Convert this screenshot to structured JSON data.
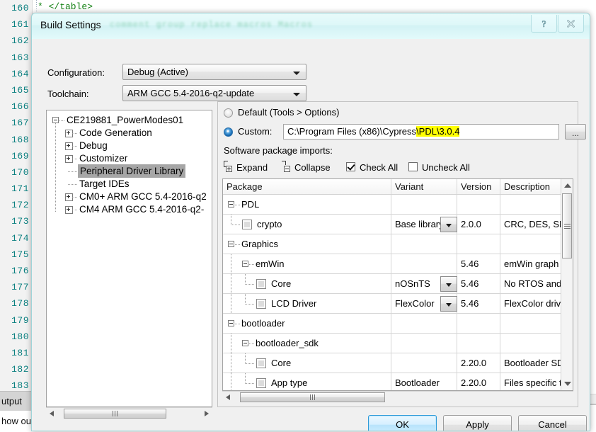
{
  "editor": {
    "line_numbers": [
      "160",
      "161",
      "162",
      "163",
      "164",
      "165",
      "166",
      "167",
      "168",
      "169",
      "170",
      "171",
      "172",
      "173",
      "174",
      "175",
      "176",
      "177",
      "178",
      "179",
      "180",
      "181",
      "182",
      "183"
    ],
    "code_first_line": "* </table>",
    "ghost_title_text": "comment group replace macros Macros"
  },
  "bottom_panel": {
    "tab_label": "utput",
    "row_label": "how ou"
  },
  "dialog": {
    "title": "Build Settings",
    "help_button": "?",
    "close_button": "✕",
    "fields": {
      "configuration_label": "Configuration:",
      "configuration_value": "Debug (Active)",
      "toolchain_label": "Toolchain:",
      "toolchain_value": "ARM GCC 5.4-2016-q2-update"
    },
    "tree": {
      "root": "CE219881_PowerModes01",
      "items": [
        {
          "label": "Code Generation",
          "expandable": true,
          "selected": false
        },
        {
          "label": "Debug",
          "expandable": true,
          "selected": false
        },
        {
          "label": "Customizer",
          "expandable": true,
          "selected": false
        },
        {
          "label": "Peripheral Driver Library",
          "expandable": false,
          "selected": true
        },
        {
          "label": "Target IDEs",
          "expandable": false,
          "selected": false
        },
        {
          "label": "CM0+ ARM GCC 5.4-2016-q2",
          "expandable": true,
          "selected": false
        },
        {
          "label": "CM4 ARM GCC 5.4-2016-q2-",
          "expandable": true,
          "selected": false
        }
      ]
    },
    "pdl": {
      "default_option": "Default (Tools > Options)",
      "custom_option": "Custom:",
      "selected_option": "custom",
      "path_prefix": "C:\\Program Files (x86)\\Cypress",
      "path_highlight": "\\PDL\\3.0.4",
      "browse_button": "...",
      "imports_label": "Software package imports:",
      "toolbar": {
        "expand": "Expand",
        "collapse": "Collapse",
        "check_all": "Check All",
        "uncheck_all": "Uncheck All",
        "check_all_state": true,
        "uncheck_all_state": false
      }
    },
    "grid": {
      "columns": [
        "Package",
        "Variant",
        "Version",
        "Description"
      ],
      "rows": [
        {
          "indent": 0,
          "kind": "group",
          "name": "PDL",
          "variant": "",
          "version": "",
          "description": ""
        },
        {
          "indent": 1,
          "kind": "item",
          "name": "crypto",
          "variant": "Base library",
          "version": "2.0.0",
          "description": "CRC, DES, SHA"
        },
        {
          "indent": 0,
          "kind": "group",
          "name": "Graphics",
          "variant": "",
          "version": "",
          "description": ""
        },
        {
          "indent": 1,
          "kind": "group",
          "name": "emWin",
          "variant": "",
          "version": "5.46",
          "description": "emWin graph"
        },
        {
          "indent": 2,
          "kind": "item",
          "name": "Core",
          "variant": "nOSnTS",
          "version": "5.46",
          "description": "No RTOS and"
        },
        {
          "indent": 2,
          "kind": "item",
          "name": "LCD Driver",
          "variant": "FlexColor",
          "version": "5.46",
          "description": "FlexColor driv"
        },
        {
          "indent": 0,
          "kind": "group",
          "name": "bootloader",
          "variant": "",
          "version": "",
          "description": ""
        },
        {
          "indent": 1,
          "kind": "group",
          "name": "bootloader_sdk",
          "variant": "",
          "version": "",
          "description": ""
        },
        {
          "indent": 2,
          "kind": "item",
          "name": "Core",
          "variant": "",
          "version": "2.20.0",
          "description": "Bootloader SD"
        },
        {
          "indent": 2,
          "kind": "item",
          "name": "App type",
          "variant": "Bootloader",
          "version": "2.20.0",
          "description": "Files specific t"
        }
      ]
    },
    "footer": {
      "ok": "OK",
      "apply": "Apply",
      "cancel": "Cancel"
    }
  },
  "colors": {
    "accent": "#2f9bd8",
    "highlight": "#ffff00",
    "title_glass": "#ddf7f8",
    "selection": "#a6a6a6",
    "code_green": "#138013",
    "line_number": "#0b8080"
  }
}
